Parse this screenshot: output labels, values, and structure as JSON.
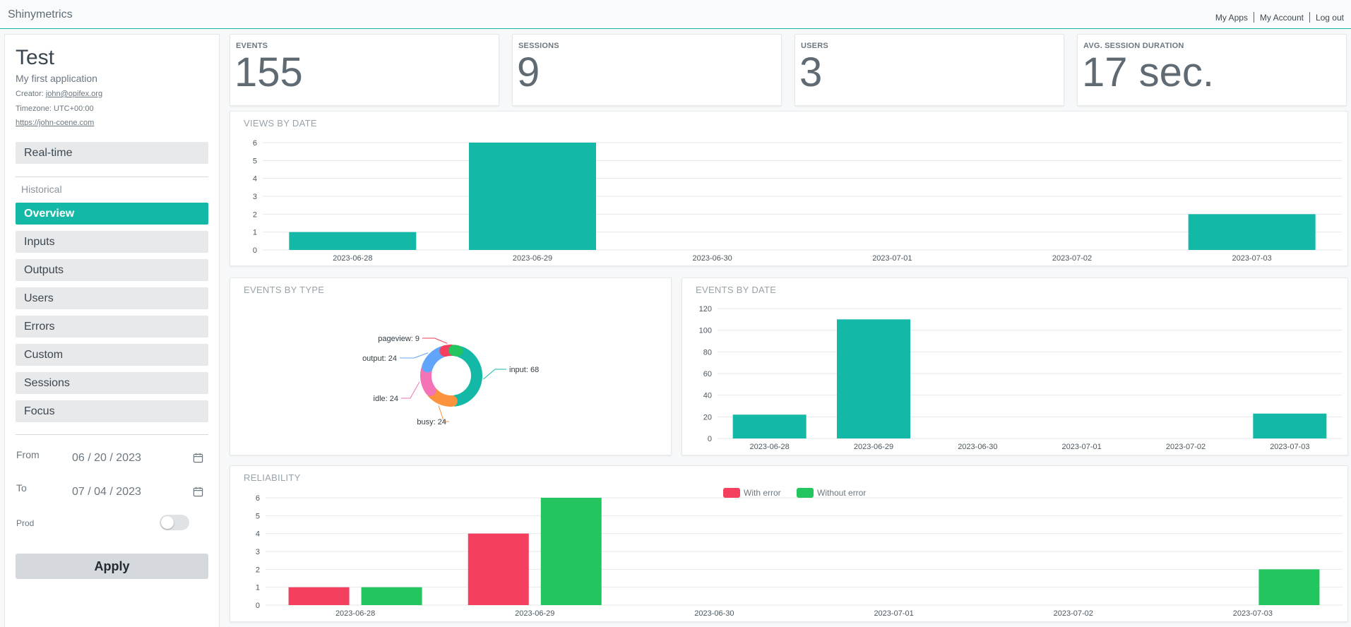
{
  "header": {
    "brand": "Shinymetrics",
    "nav": [
      "My Apps",
      "My Account",
      "Log out"
    ]
  },
  "sidebar": {
    "app_title": "Test",
    "app_desc": "My first application",
    "creator_label": "Creator:",
    "creator_email": "john@opifex.org",
    "timezone": "Timezone: UTC+00:00",
    "url": "https://john-coene.com",
    "realtime": "Real-time",
    "historical_label": "Historical",
    "items": [
      "Overview",
      "Inputs",
      "Outputs",
      "Users",
      "Errors",
      "Custom",
      "Sessions",
      "Focus"
    ],
    "active_item": "Overview",
    "from_label": "From",
    "from_value": "06 / 20 / 2023",
    "to_label": "To",
    "to_value": "07 / 04 / 2023",
    "prod_label": "Prod",
    "prod_enabled": false,
    "apply": "Apply"
  },
  "stats": [
    {
      "label": "EVENTS",
      "value": "155"
    },
    {
      "label": "SESSIONS",
      "value": "9"
    },
    {
      "label": "USERS",
      "value": "3"
    },
    {
      "label": "AVG. SESSION DURATION",
      "value": "17 sec."
    }
  ],
  "colors": {
    "accent": "#14b8a6",
    "error": "#f43f5e",
    "success": "#22c55e",
    "pie": {
      "input": "#14b8a6",
      "busy": "#fb923c",
      "idle": "#f472b6",
      "output": "#60a5fa",
      "pageview": "#f43f5e",
      "other": "#22c55e"
    }
  },
  "chart_data": [
    {
      "type": "bar",
      "title": "VIEWS BY DATE",
      "categories": [
        "2023-06-28",
        "2023-06-29",
        "2023-06-30",
        "2023-07-01",
        "2023-07-02",
        "2023-07-03"
      ],
      "values": [
        1,
        6,
        0,
        0,
        0,
        2
      ],
      "yticks": [
        0,
        1,
        2,
        3,
        4,
        5,
        6
      ],
      "ylim": [
        0,
        6
      ],
      "grid": true
    },
    {
      "type": "pie",
      "title": "EVENTS BY TYPE",
      "donut": true,
      "slices": [
        {
          "label": "input",
          "value": 68
        },
        {
          "label": "busy",
          "value": 24
        },
        {
          "label": "idle",
          "value": 24
        },
        {
          "label": "output",
          "value": 24
        },
        {
          "label": "pageview",
          "value": 9
        },
        {
          "label": "",
          "value": 6
        }
      ]
    },
    {
      "type": "bar",
      "title": "EVENTS BY DATE",
      "categories": [
        "2023-06-28",
        "2023-06-29",
        "2023-06-30",
        "2023-07-01",
        "2023-07-02",
        "2023-07-03"
      ],
      "values": [
        22,
        110,
        0,
        0,
        0,
        23
      ],
      "yticks": [
        0,
        20,
        40,
        60,
        80,
        100,
        120
      ],
      "ylim": [
        0,
        120
      ],
      "grid": true
    },
    {
      "type": "bar",
      "title": "RELIABILITY",
      "categories": [
        "2023-06-28",
        "2023-06-29",
        "2023-06-30",
        "2023-07-01",
        "2023-07-02",
        "2023-07-03"
      ],
      "series": [
        {
          "name": "With error",
          "values": [
            1,
            4,
            0,
            0,
            0,
            0
          ]
        },
        {
          "name": "Without error",
          "values": [
            1,
            6,
            0,
            0,
            0,
            2
          ]
        }
      ],
      "yticks": [
        0,
        1,
        2,
        3,
        4,
        5,
        6
      ],
      "ylim": [
        0,
        6
      ],
      "legend": "top-center",
      "grid": true
    }
  ]
}
